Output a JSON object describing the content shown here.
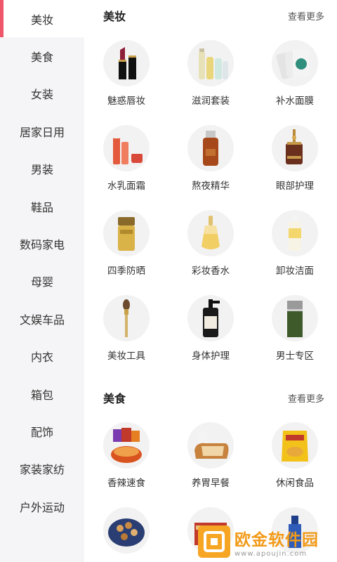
{
  "sidebar": {
    "items": [
      {
        "label": "美妆"
      },
      {
        "label": "美食"
      },
      {
        "label": "女装"
      },
      {
        "label": "居家日用"
      },
      {
        "label": "男装"
      },
      {
        "label": "鞋品"
      },
      {
        "label": "数码家电"
      },
      {
        "label": "母婴"
      },
      {
        "label": "文娱车品"
      },
      {
        "label": "内衣"
      },
      {
        "label": "箱包"
      },
      {
        "label": "配饰"
      },
      {
        "label": "家装家纺"
      },
      {
        "label": "户外运动"
      }
    ],
    "active_index": 0,
    "accent_color": "#f0566a"
  },
  "sections": [
    {
      "title": "美妆",
      "more": "查看更多",
      "items": [
        {
          "label": "魅惑唇妆",
          "icon": "lipstick-icon"
        },
        {
          "label": "滋润套装",
          "icon": "skincare-set-icon"
        },
        {
          "label": "补水面膜",
          "icon": "face-mask-icon"
        },
        {
          "label": "水乳面霜",
          "icon": "cream-set-icon"
        },
        {
          "label": "熬夜精华",
          "icon": "serum-bottle-icon"
        },
        {
          "label": "眼部护理",
          "icon": "eye-care-bottle-icon"
        },
        {
          "label": "四季防晒",
          "icon": "sunscreen-icon"
        },
        {
          "label": "彩妆香水",
          "icon": "perfume-icon"
        },
        {
          "label": "卸妆洁面",
          "icon": "cleanser-bottle-icon"
        },
        {
          "label": "美妆工具",
          "icon": "makeup-brush-icon"
        },
        {
          "label": "身体护理",
          "icon": "body-care-bottle-icon"
        },
        {
          "label": "男士专区",
          "icon": "men-spray-icon"
        }
      ]
    },
    {
      "title": "美食",
      "more": "查看更多",
      "items": [
        {
          "label": "香辣速食",
          "icon": "spicy-food-icon"
        },
        {
          "label": "养胃早餐",
          "icon": "bread-icon"
        },
        {
          "label": "休闲食品",
          "icon": "chips-bag-icon"
        },
        {
          "label": "",
          "icon": "cookie-tin-icon"
        },
        {
          "label": "",
          "icon": "gift-box-icon"
        },
        {
          "label": "",
          "icon": "bottle-icon"
        }
      ]
    }
  ],
  "watermark": {
    "text": "欧金软件园",
    "url": "www.apoujin.com"
  }
}
